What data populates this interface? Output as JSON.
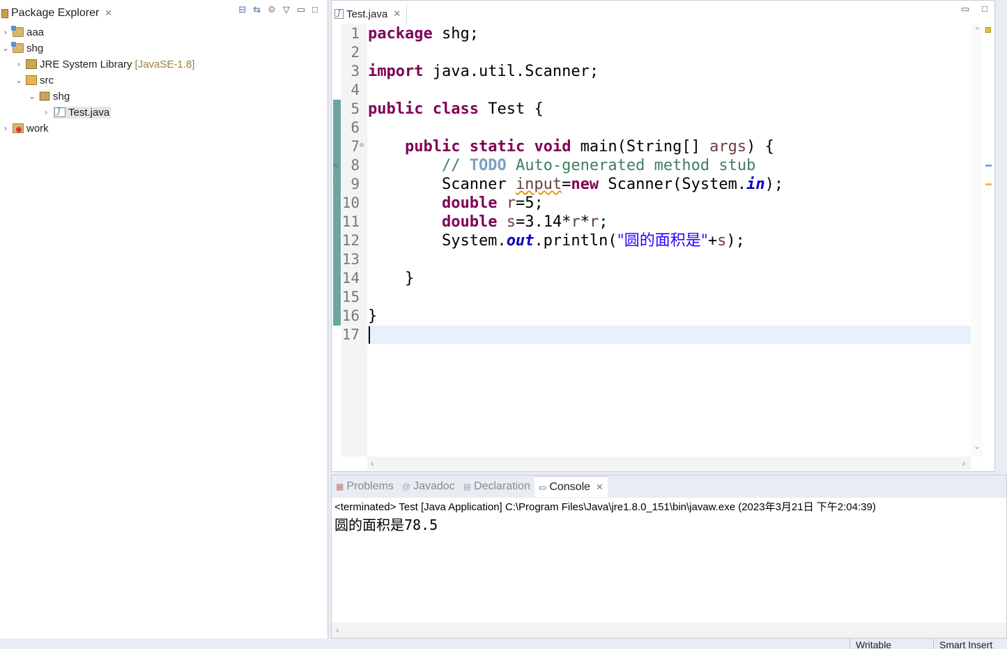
{
  "package_explorer": {
    "title": "Package Explorer",
    "tree": [
      {
        "label": "aaa",
        "decoration": "",
        "level": 0,
        "expanded": false,
        "icon": "project-icon"
      },
      {
        "label": "shg",
        "decoration": "",
        "level": 0,
        "expanded": true,
        "icon": "project-icon"
      },
      {
        "label": "JRE System Library",
        "decoration": "[JavaSE-1.8]",
        "level": 1,
        "expanded": false,
        "icon": "library-icon"
      },
      {
        "label": "src",
        "decoration": "",
        "level": 1,
        "expanded": true,
        "icon": "source-folder-icon"
      },
      {
        "label": "shg",
        "decoration": "",
        "level": 2,
        "expanded": true,
        "icon": "package-icon"
      },
      {
        "label": "Test.java",
        "decoration": "",
        "level": 3,
        "expanded": false,
        "icon": "java-file-icon",
        "selected": true
      },
      {
        "label": "work",
        "decoration": "",
        "level": 0,
        "expanded": false,
        "icon": "project-error-icon"
      }
    ]
  },
  "editor": {
    "tab_title": "Test.java",
    "line_numbers": [
      "1",
      "2",
      "3",
      "4",
      "5",
      "6",
      "7",
      "8",
      "9",
      "10",
      "11",
      "12",
      "13",
      "14",
      "15",
      "16",
      "17"
    ],
    "current_line": 17
  },
  "console": {
    "tabs": [
      "Problems",
      "Javadoc",
      "Declaration",
      "Console"
    ],
    "active_tab": "Console",
    "status_line": "<terminated> Test [Java Application] C:\\Program Files\\Java\\jre1.8.0_151\\bin\\javaw.exe (2023年3月21日 下午2:04:39)",
    "output_label": "圆的面积是",
    "output_value": "78.5"
  },
  "statusbar": {
    "writable": "Writable",
    "insert_mode": "Smart Insert"
  },
  "colors": {
    "keyword": "#7f0055",
    "comment": "#3f7f5f",
    "string": "#2a00ff",
    "field": "#0000c0",
    "local_var": "#6a3e3e",
    "current_line": "#e8f0fb"
  }
}
